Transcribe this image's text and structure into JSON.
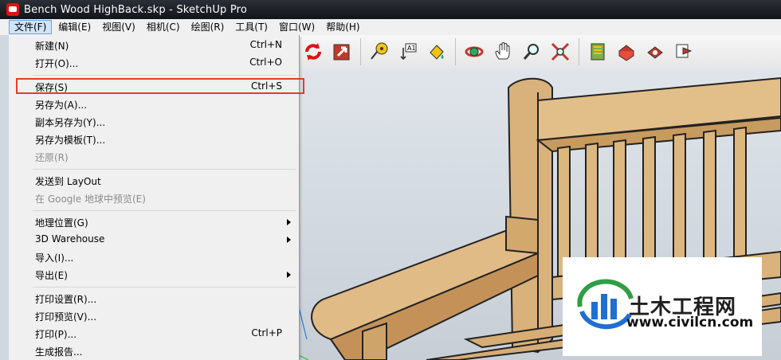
{
  "window": {
    "title": "Bench Wood HighBack.skp - SketchUp Pro"
  },
  "menubar": [
    {
      "label": "文件(F)"
    },
    {
      "label": "编辑(E)"
    },
    {
      "label": "视图(V)"
    },
    {
      "label": "相机(C)"
    },
    {
      "label": "绘图(R)"
    },
    {
      "label": "工具(T)"
    },
    {
      "label": "窗口(W)"
    },
    {
      "label": "帮助(H)"
    }
  ],
  "file_menu": {
    "items": [
      {
        "label": "新建(N)",
        "shortcut": "Ctrl+N"
      },
      {
        "label": "打开(O)...",
        "shortcut": "Ctrl+O"
      },
      {
        "label": "保存(S)",
        "shortcut": "Ctrl+S"
      },
      {
        "label": "另存为(A)...",
        "shortcut": ""
      },
      {
        "label": "副本另存为(Y)...",
        "shortcut": ""
      },
      {
        "label": "另存为模板(T)...",
        "shortcut": ""
      },
      {
        "label": "还原(R)",
        "shortcut": ""
      },
      {
        "label": "发送到 LayOut",
        "shortcut": ""
      },
      {
        "label": "在 Google 地球中预览(E)",
        "shortcut": ""
      },
      {
        "label": "地理位置(G)",
        "shortcut": ""
      },
      {
        "label": "3D Warehouse",
        "shortcut": ""
      },
      {
        "label": "导入(I)...",
        "shortcut": ""
      },
      {
        "label": "导出(E)",
        "shortcut": ""
      },
      {
        "label": "打印设置(R)...",
        "shortcut": ""
      },
      {
        "label": "打印预览(V)...",
        "shortcut": ""
      },
      {
        "label": "打印(P)...",
        "shortcut": "Ctrl+P"
      },
      {
        "label": "生成报告...",
        "shortcut": ""
      }
    ]
  },
  "watermark": {
    "brand": "土木工程网",
    "url": "www.civilcn.com"
  },
  "toolbar_icons": [
    "rotate-icon",
    "zoom-window-icon",
    "tape-measure-icon",
    "text-icon",
    "paint-bucket-icon",
    "orbit-icon",
    "pan-icon",
    "zoom-icon",
    "zoom-extents-icon",
    "3d-warehouse-icon",
    "get-models-icon",
    "share-model-icon",
    "share-component-icon"
  ]
}
